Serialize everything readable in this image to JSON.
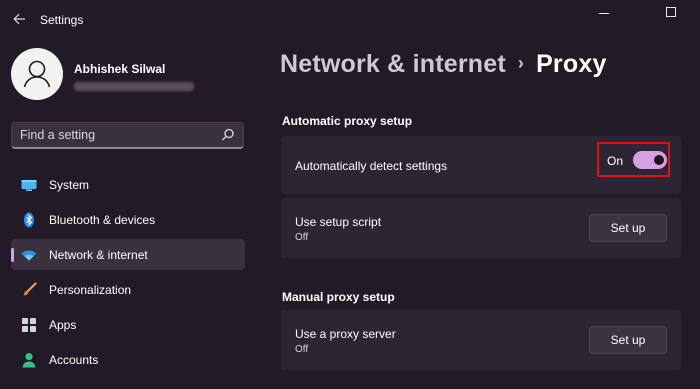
{
  "window": {
    "app_title": "Settings",
    "back_icon": "arrow-left-icon",
    "minimize_icon": "minimize-icon",
    "maximize_icon": "maximize-icon"
  },
  "profile": {
    "name": "Abhishek Silwal",
    "avatar_icon": "person-icon"
  },
  "search": {
    "placeholder": "Find a setting",
    "value": "",
    "icon": "search-icon"
  },
  "sidebar": {
    "items": [
      {
        "label": "System",
        "icon": "monitor-icon"
      },
      {
        "label": "Bluetooth & devices",
        "icon": "bluetooth-icon"
      },
      {
        "label": "Network & internet",
        "icon": "wifi-icon",
        "selected": true
      },
      {
        "label": "Personalization",
        "icon": "brush-icon"
      },
      {
        "label": "Apps",
        "icon": "apps-grid-icon"
      },
      {
        "label": "Accounts",
        "icon": "person-icon"
      }
    ]
  },
  "breadcrumb": {
    "parent": "Network & internet",
    "separator": "›",
    "current": "Proxy"
  },
  "automatic": {
    "heading": "Automatic proxy setup",
    "detect": {
      "label": "Automatically detect settings",
      "toggle_text": "On",
      "toggle_on": true
    },
    "script": {
      "label": "Use setup script",
      "status": "Off",
      "button": "Set up"
    }
  },
  "manual": {
    "heading": "Manual proxy setup",
    "proxy_server": {
      "label": "Use a proxy server",
      "status": "Off",
      "button": "Set up"
    }
  },
  "colors": {
    "background": "#231a28",
    "card": "#2d2533",
    "accent": "#d7a0e3",
    "highlight_border": "#e0101c"
  }
}
